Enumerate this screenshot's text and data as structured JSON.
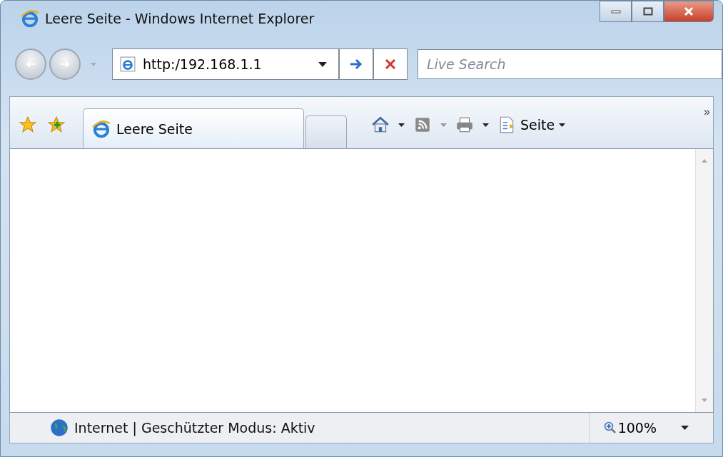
{
  "window": {
    "title": "Leere Seite - Windows Internet Explorer"
  },
  "address_bar": {
    "value": "http:/192.168.1.1"
  },
  "search": {
    "placeholder": "Live Search"
  },
  "tabs": [
    {
      "label": "Leere Seite",
      "selected": true
    }
  ],
  "command_bar": {
    "page_menu": "Seite",
    "overflow": "»"
  },
  "status_bar": {
    "zone": "Internet | Geschützter Modus: Aktiv",
    "zoom": "100%"
  }
}
